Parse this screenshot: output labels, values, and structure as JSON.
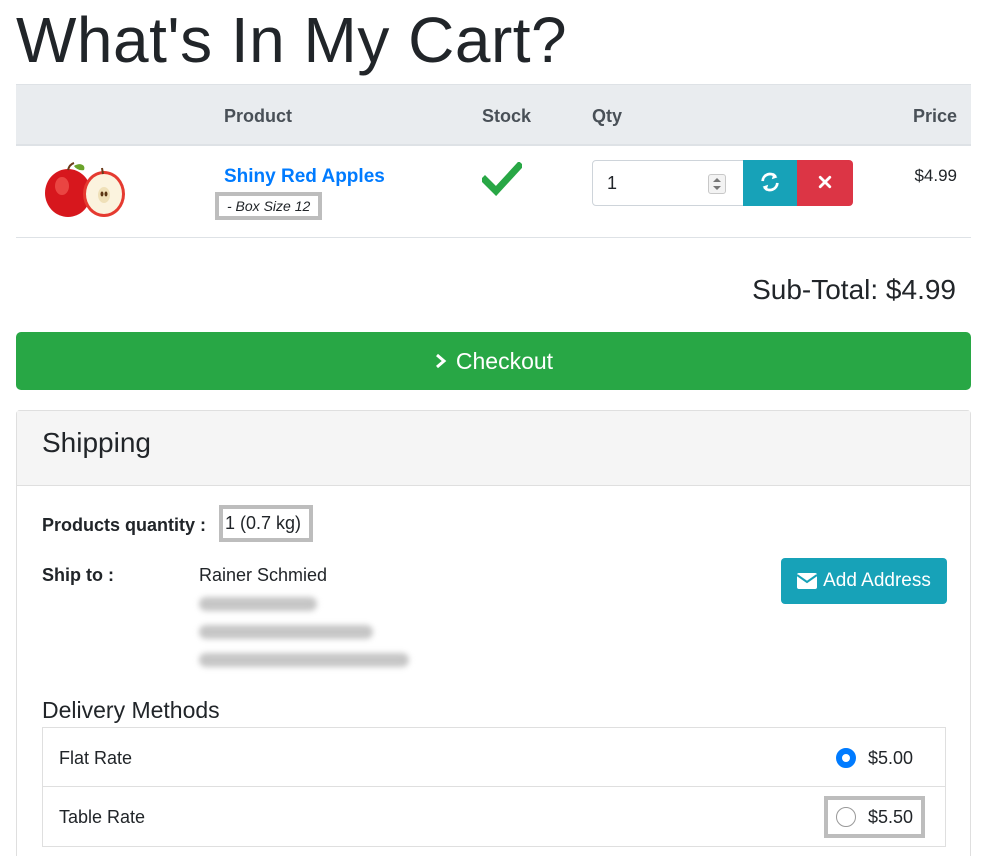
{
  "page": {
    "title": "What's In My Cart?"
  },
  "cart": {
    "headers": {
      "product": "Product",
      "stock": "Stock",
      "qty": "Qty",
      "price": "Price"
    },
    "items": [
      {
        "name": "Shiny Red Apples",
        "option": "- Box Size 12",
        "qty": "1",
        "price": "$4.99",
        "in_stock": true
      }
    ]
  },
  "subtotal": "Sub-Total: $4.99",
  "checkout": {
    "label": "Checkout"
  },
  "shipping": {
    "title": "Shipping",
    "qty_label": "Products quantity :",
    "qty_value": "1 (0.7 kg)",
    "ship_to_label": "Ship to :",
    "ship_to_name": "Rainer Schmied",
    "add_address_label": "Add Address",
    "delivery_title": "Delivery Methods",
    "methods": [
      {
        "name": "Flat Rate",
        "price": "$5.00",
        "selected": true
      },
      {
        "name": "Table Rate",
        "price": "$5.50",
        "selected": false
      }
    ]
  },
  "colors": {
    "primary": "#007bff",
    "success": "#28a745",
    "info": "#17a2b8",
    "danger": "#dc3545"
  },
  "icons": {
    "stock": "check-icon",
    "refresh": "refresh-icon",
    "remove": "close-icon",
    "checkout": "chevron-right-icon",
    "address": "envelope-icon"
  }
}
